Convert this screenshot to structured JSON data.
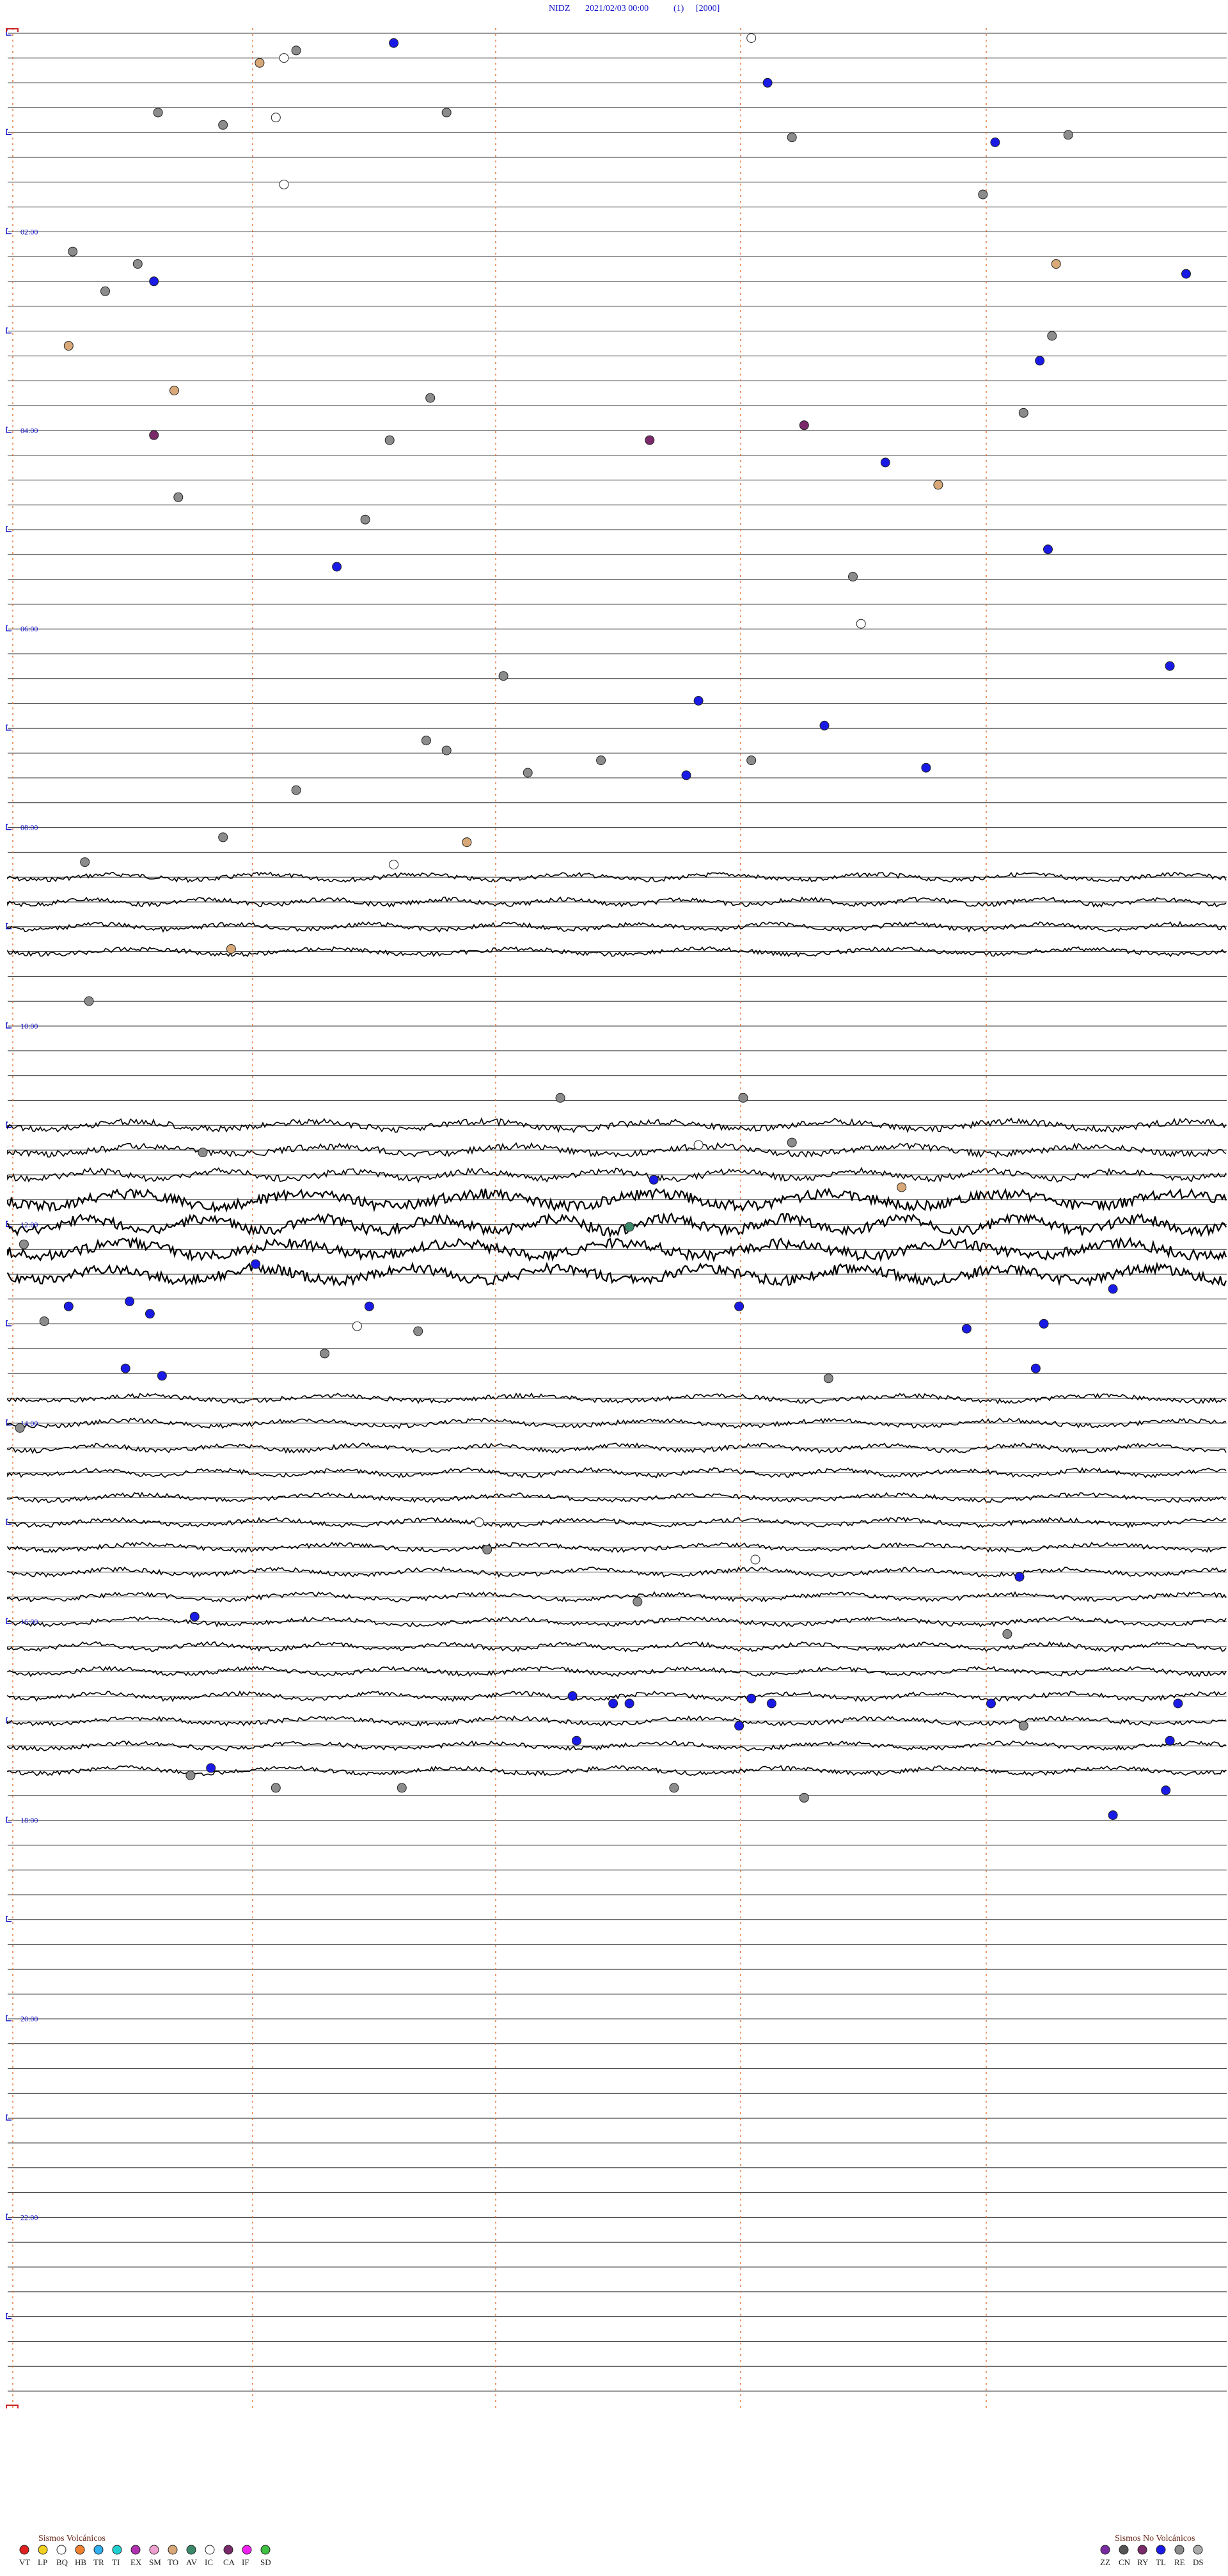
{
  "header": {
    "station": "NIDZ",
    "date_time": "2021/02/03 00:00",
    "component": "(1)",
    "gain": "[2000]"
  },
  "chart_data": {
    "type": "helicorder",
    "start": "2021/02/03 00:00",
    "end": "2021/02/04 00:00",
    "lines_per_hour": 4,
    "total_lines": 96,
    "hour_labels": [
      "02:00",
      "04:00",
      "06:00",
      "08:00",
      "10:00",
      "12:00",
      "14:00",
      "16:00",
      "18:00",
      "20:00",
      "22:00"
    ],
    "minute_markers": [
      0,
      3,
      6,
      9,
      12
    ],
    "colors": {
      "trace": "#000000",
      "baseline": "#333333",
      "markers": "#e07030",
      "hour_label": "#1010c8",
      "bracket": "#cc2222",
      "gray": "#8c8c8c",
      "white": "#ffffff",
      "blue": "#1a1ae6",
      "tan": "#d8a878",
      "purple": "#7a2a6a",
      "green": "#3a8a6a",
      "dark": "#555555"
    },
    "active_segments": [
      {
        "from_line": 34,
        "to_line": 37,
        "amplitude": "moderate"
      },
      {
        "from_line": 44,
        "to_line": 46,
        "amplitude": "high"
      },
      {
        "from_line": 47,
        "to_line": 50,
        "amplitude": "very_high"
      },
      {
        "from_line": 55,
        "to_line": 61,
        "amplitude": "moderate"
      },
      {
        "from_line": 62,
        "to_line": 66,
        "amplitude": "moderate"
      },
      {
        "from_line": 67,
        "to_line": 70,
        "amplitude": "moderate"
      }
    ],
    "events": [
      {
        "line": 0.9,
        "minute": 7.1,
        "type": "gray"
      },
      {
        "line": 1.2,
        "minute": 6.8,
        "type": "white"
      },
      {
        "line": 0.6,
        "minute": 9.5,
        "type": "blue"
      },
      {
        "line": 1.4,
        "minute": 6.2,
        "type": "tan"
      },
      {
        "line": 0.4,
        "minute": 18.3,
        "type": "white"
      },
      {
        "line": 2.2,
        "minute": 18.7,
        "type": "blue"
      },
      {
        "line": 3.4,
        "minute": 3.7,
        "type": "gray"
      },
      {
        "line": 3.4,
        "minute": 10.8,
        "type": "gray"
      },
      {
        "line": 3.6,
        "minute": 6.6,
        "type": "white"
      },
      {
        "line": 3.9,
        "minute": 5.3,
        "type": "gray"
      },
      {
        "line": 4.4,
        "minute": 19.3,
        "type": "gray"
      },
      {
        "line": 4.6,
        "minute": 24.3,
        "type": "blue"
      },
      {
        "line": 4.3,
        "minute": 26.1,
        "type": "gray"
      },
      {
        "line": 6.3,
        "minute": 6.8,
        "type": "white"
      },
      {
        "line": 6.7,
        "minute": 24.0,
        "type": "gray"
      },
      {
        "line": 9.0,
        "minute": 1.6,
        "type": "gray"
      },
      {
        "line": 9.5,
        "minute": 3.2,
        "type": "gray"
      },
      {
        "line": 9.5,
        "minute": 25.8,
        "type": "tan"
      },
      {
        "line": 9.9,
        "minute": 29.0,
        "type": "blue"
      },
      {
        "line": 10.2,
        "minute": 3.6,
        "type": "blue"
      },
      {
        "line": 10.6,
        "minute": 2.4,
        "type": "gray"
      },
      {
        "line": 12.4,
        "minute": 25.7,
        "type": "gray"
      },
      {
        "line": 12.8,
        "minute": 1.5,
        "type": "tan"
      },
      {
        "line": 13.4,
        "minute": 25.4,
        "type": "blue"
      },
      {
        "line": 14.6,
        "minute": 4.1,
        "type": "tan"
      },
      {
        "line": 14.9,
        "minute": 10.4,
        "type": "gray"
      },
      {
        "line": 15.5,
        "minute": 25.0,
        "type": "gray"
      },
      {
        "line": 16.0,
        "minute": 19.6,
        "type": "purple"
      },
      {
        "line": 16.4,
        "minute": 3.6,
        "type": "purple"
      },
      {
        "line": 16.6,
        "minute": 9.4,
        "type": "gray"
      },
      {
        "line": 16.6,
        "minute": 15.8,
        "type": "purple"
      },
      {
        "line": 17.5,
        "minute": 21.6,
        "type": "blue"
      },
      {
        "line": 18.4,
        "minute": 22.9,
        "type": "tan"
      },
      {
        "line": 18.9,
        "minute": 4.2,
        "type": "gray"
      },
      {
        "line": 19.8,
        "minute": 8.8,
        "type": "gray"
      },
      {
        "line": 21.0,
        "minute": 25.6,
        "type": "blue"
      },
      {
        "line": 21.7,
        "minute": 8.1,
        "type": "blue"
      },
      {
        "line": 22.1,
        "minute": 20.8,
        "type": "gray"
      },
      {
        "line": 24.0,
        "minute": 21.0,
        "type": "white"
      },
      {
        "line": 25.7,
        "minute": 28.6,
        "type": "blue"
      },
      {
        "line": 26.1,
        "minute": 12.2,
        "type": "gray"
      },
      {
        "line": 27.1,
        "minute": 17.0,
        "type": "blue"
      },
      {
        "line": 28.1,
        "minute": 20.1,
        "type": "blue"
      },
      {
        "line": 28.7,
        "minute": 10.3,
        "type": "gray"
      },
      {
        "line": 29.1,
        "minute": 10.8,
        "type": "gray"
      },
      {
        "line": 29.5,
        "minute": 14.6,
        "type": "gray"
      },
      {
        "line": 29.5,
        "minute": 18.3,
        "type": "gray"
      },
      {
        "line": 29.8,
        "minute": 22.6,
        "type": "blue"
      },
      {
        "line": 30.0,
        "minute": 12.8,
        "type": "gray"
      },
      {
        "line": 30.1,
        "minute": 16.7,
        "type": "blue"
      },
      {
        "line": 30.7,
        "minute": 7.1,
        "type": "gray"
      },
      {
        "line": 32.6,
        "minute": 5.3,
        "type": "gray"
      },
      {
        "line": 32.8,
        "minute": 11.3,
        "type": "tan"
      },
      {
        "line": 33.6,
        "minute": 1.9,
        "type": "gray"
      },
      {
        "line": 33.7,
        "minute": 9.5,
        "type": "white"
      },
      {
        "line": 37.1,
        "minute": 5.5,
        "type": "tan"
      },
      {
        "line": 39.2,
        "minute": 2.0,
        "type": "gray"
      },
      {
        "line": 43.1,
        "minute": 13.6,
        "type": "gray"
      },
      {
        "line": 43.1,
        "minute": 18.1,
        "type": "gray"
      },
      {
        "line": 44.9,
        "minute": 19.3,
        "type": "gray"
      },
      {
        "line": 45.0,
        "minute": 17.0,
        "type": "white"
      },
      {
        "line": 45.3,
        "minute": 4.8,
        "type": "gray"
      },
      {
        "line": 46.4,
        "minute": 15.9,
        "type": "blue"
      },
      {
        "line": 46.7,
        "minute": 22.0,
        "type": "tan"
      },
      {
        "line": 48.3,
        "minute": 15.3,
        "type": "green"
      },
      {
        "line": 49.0,
        "minute": 0.4,
        "type": "gray"
      },
      {
        "line": 49.8,
        "minute": 6.1,
        "type": "blue"
      },
      {
        "line": 50.8,
        "minute": 27.2,
        "type": "blue"
      },
      {
        "line": 51.5,
        "minute": 1.5,
        "type": "blue"
      },
      {
        "line": 51.3,
        "minute": 3.0,
        "type": "blue"
      },
      {
        "line": 51.8,
        "minute": 3.5,
        "type": "blue"
      },
      {
        "line": 51.5,
        "minute": 8.9,
        "type": "blue"
      },
      {
        "line": 51.5,
        "minute": 18.0,
        "type": "blue"
      },
      {
        "line": 52.1,
        "minute": 0.9,
        "type": "gray"
      },
      {
        "line": 52.3,
        "minute": 8.6,
        "type": "white"
      },
      {
        "line": 52.5,
        "minute": 10.1,
        "type": "gray"
      },
      {
        "line": 52.4,
        "minute": 23.6,
        "type": "blue"
      },
      {
        "line": 52.2,
        "minute": 25.5,
        "type": "blue"
      },
      {
        "line": 53.4,
        "minute": 7.8,
        "type": "gray"
      },
      {
        "line": 54.0,
        "minute": 2.9,
        "type": "blue"
      },
      {
        "line": 54.3,
        "minute": 3.8,
        "type": "blue"
      },
      {
        "line": 54.4,
        "minute": 20.2,
        "type": "gray"
      },
      {
        "line": 54.0,
        "minute": 25.3,
        "type": "blue"
      },
      {
        "line": 56.4,
        "minute": 0.3,
        "type": "gray"
      },
      {
        "line": 60.2,
        "minute": 11.6,
        "type": "white"
      },
      {
        "line": 61.3,
        "minute": 11.8,
        "type": "gray"
      },
      {
        "line": 61.7,
        "minute": 18.4,
        "type": "white"
      },
      {
        "line": 62.4,
        "minute": 24.9,
        "type": "blue"
      },
      {
        "line": 63.4,
        "minute": 15.5,
        "type": "gray"
      },
      {
        "line": 64.0,
        "minute": 4.6,
        "type": "blue"
      },
      {
        "line": 64.7,
        "minute": 24.6,
        "type": "gray"
      },
      {
        "line": 67.2,
        "minute": 13.9,
        "type": "blue"
      },
      {
        "line": 67.5,
        "minute": 14.9,
        "type": "blue"
      },
      {
        "line": 67.5,
        "minute": 15.3,
        "type": "blue"
      },
      {
        "line": 67.5,
        "minute": 18.8,
        "type": "blue"
      },
      {
        "line": 67.3,
        "minute": 18.3,
        "type": "blue"
      },
      {
        "line": 67.5,
        "minute": 24.2,
        "type": "blue"
      },
      {
        "line": 67.5,
        "minute": 28.8,
        "type": "blue"
      },
      {
        "line": 68.4,
        "minute": 18.0,
        "type": "blue"
      },
      {
        "line": 68.4,
        "minute": 25.0,
        "type": "gray"
      },
      {
        "line": 69.0,
        "minute": 14.0,
        "type": "blue"
      },
      {
        "line": 69.0,
        "minute": 28.6,
        "type": "blue"
      },
      {
        "line": 70.1,
        "minute": 5.0,
        "type": "blue"
      },
      {
        "line": 70.4,
        "minute": 4.5,
        "type": "gray"
      },
      {
        "line": 70.9,
        "minute": 9.7,
        "type": "gray"
      },
      {
        "line": 70.9,
        "minute": 6.6,
        "type": "gray"
      },
      {
        "line": 70.9,
        "minute": 16.4,
        "type": "gray"
      },
      {
        "line": 71.3,
        "minute": 19.6,
        "type": "gray"
      },
      {
        "line": 71.0,
        "minute": 28.5,
        "type": "blue"
      },
      {
        "line": 72.0,
        "minute": 27.2,
        "type": "blue"
      }
    ],
    "legend_volcanic": {
      "title": "Sismos Volcánicos",
      "codes": [
        "VT",
        "LP",
        "BQ",
        "HB",
        "TR",
        "TI",
        "EX",
        "SM",
        "TO",
        "AV",
        "IC",
        "CA",
        "IF",
        "SD"
      ],
      "colors": [
        "#e02020",
        "#f0d020",
        "#ffffff",
        "#f08030",
        "#30b0f0",
        "#20d0d0",
        "#b030b0",
        "#f0a0d0",
        "#d8a878",
        "#3a8a6a",
        "#ffffff",
        "#7a2a6a",
        "#f020f0",
        "#40c040"
      ]
    },
    "legend_nonvolcanic": {
      "title": "Sismos No Volcánicos",
      "codes": [
        "ZZ",
        "CN",
        "RY",
        "TL",
        "RE",
        "DS"
      ],
      "colors": [
        "#7a2aa0",
        "#555555",
        "#7a2a6a",
        "#1a1ae6",
        "#8c8c8c",
        "#aaaaaa"
      ]
    }
  }
}
